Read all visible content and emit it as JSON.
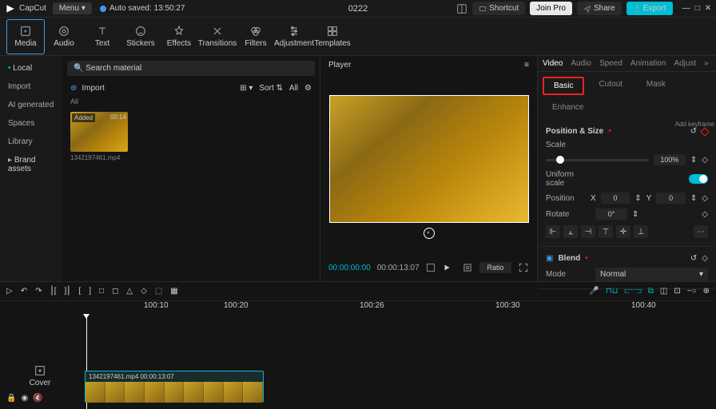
{
  "title": "0222",
  "brand": "CapCut",
  "menuLabel": "Menu",
  "autosave": "Auto saved: 13:50:27",
  "topButtons": {
    "shortcut": "Shortcut",
    "joinPro": "Join Pro",
    "share": "Share",
    "export": "Export"
  },
  "tools": [
    {
      "label": "Media"
    },
    {
      "label": "Audio"
    },
    {
      "label": "Text"
    },
    {
      "label": "Stickers"
    },
    {
      "label": "Effects"
    },
    {
      "label": "Transitions"
    },
    {
      "label": "Filters"
    },
    {
      "label": "Adjustment"
    },
    {
      "label": "Templates"
    }
  ],
  "sidebar": [
    "Local",
    "Import",
    "AI generated",
    "Spaces",
    "Library",
    "Brand assets"
  ],
  "searchPlaceholder": "Search material",
  "importBtn": "Import",
  "sort": "Sort",
  "allBtn": "All",
  "allLabel": "All",
  "clip": {
    "badge": "Added",
    "duration": "00:14",
    "name": "1342197461.mp4",
    "clipHeader": "1342197461.mp4  00:00:13:07"
  },
  "player": {
    "title": "Player",
    "current": "00:00:00:00",
    "total": "00:00:13:07",
    "ratio": "Ratio"
  },
  "inspectorTabs": [
    "Video",
    "Audio",
    "Speed",
    "Animation",
    "Adjust"
  ],
  "subtabs": [
    "Basic",
    "Cutout",
    "Mask",
    "Enhance"
  ],
  "addKeyframe": "Add keyframe",
  "posSize": "Position & Size",
  "scale": "Scale",
  "scaleVal": "100%",
  "uniform": "Uniform scale",
  "position": "Position",
  "x": "X",
  "y": "Y",
  "xVal": "0",
  "yVal": "0",
  "rotate": "Rotate",
  "rotateVal": "0°",
  "blend": "Blend",
  "mode": "Mode",
  "modeVal": "Normal",
  "cover": "Cover",
  "ruler": [
    "100:10",
    "100:20",
    "100:26",
    "100:30",
    "100:40"
  ]
}
